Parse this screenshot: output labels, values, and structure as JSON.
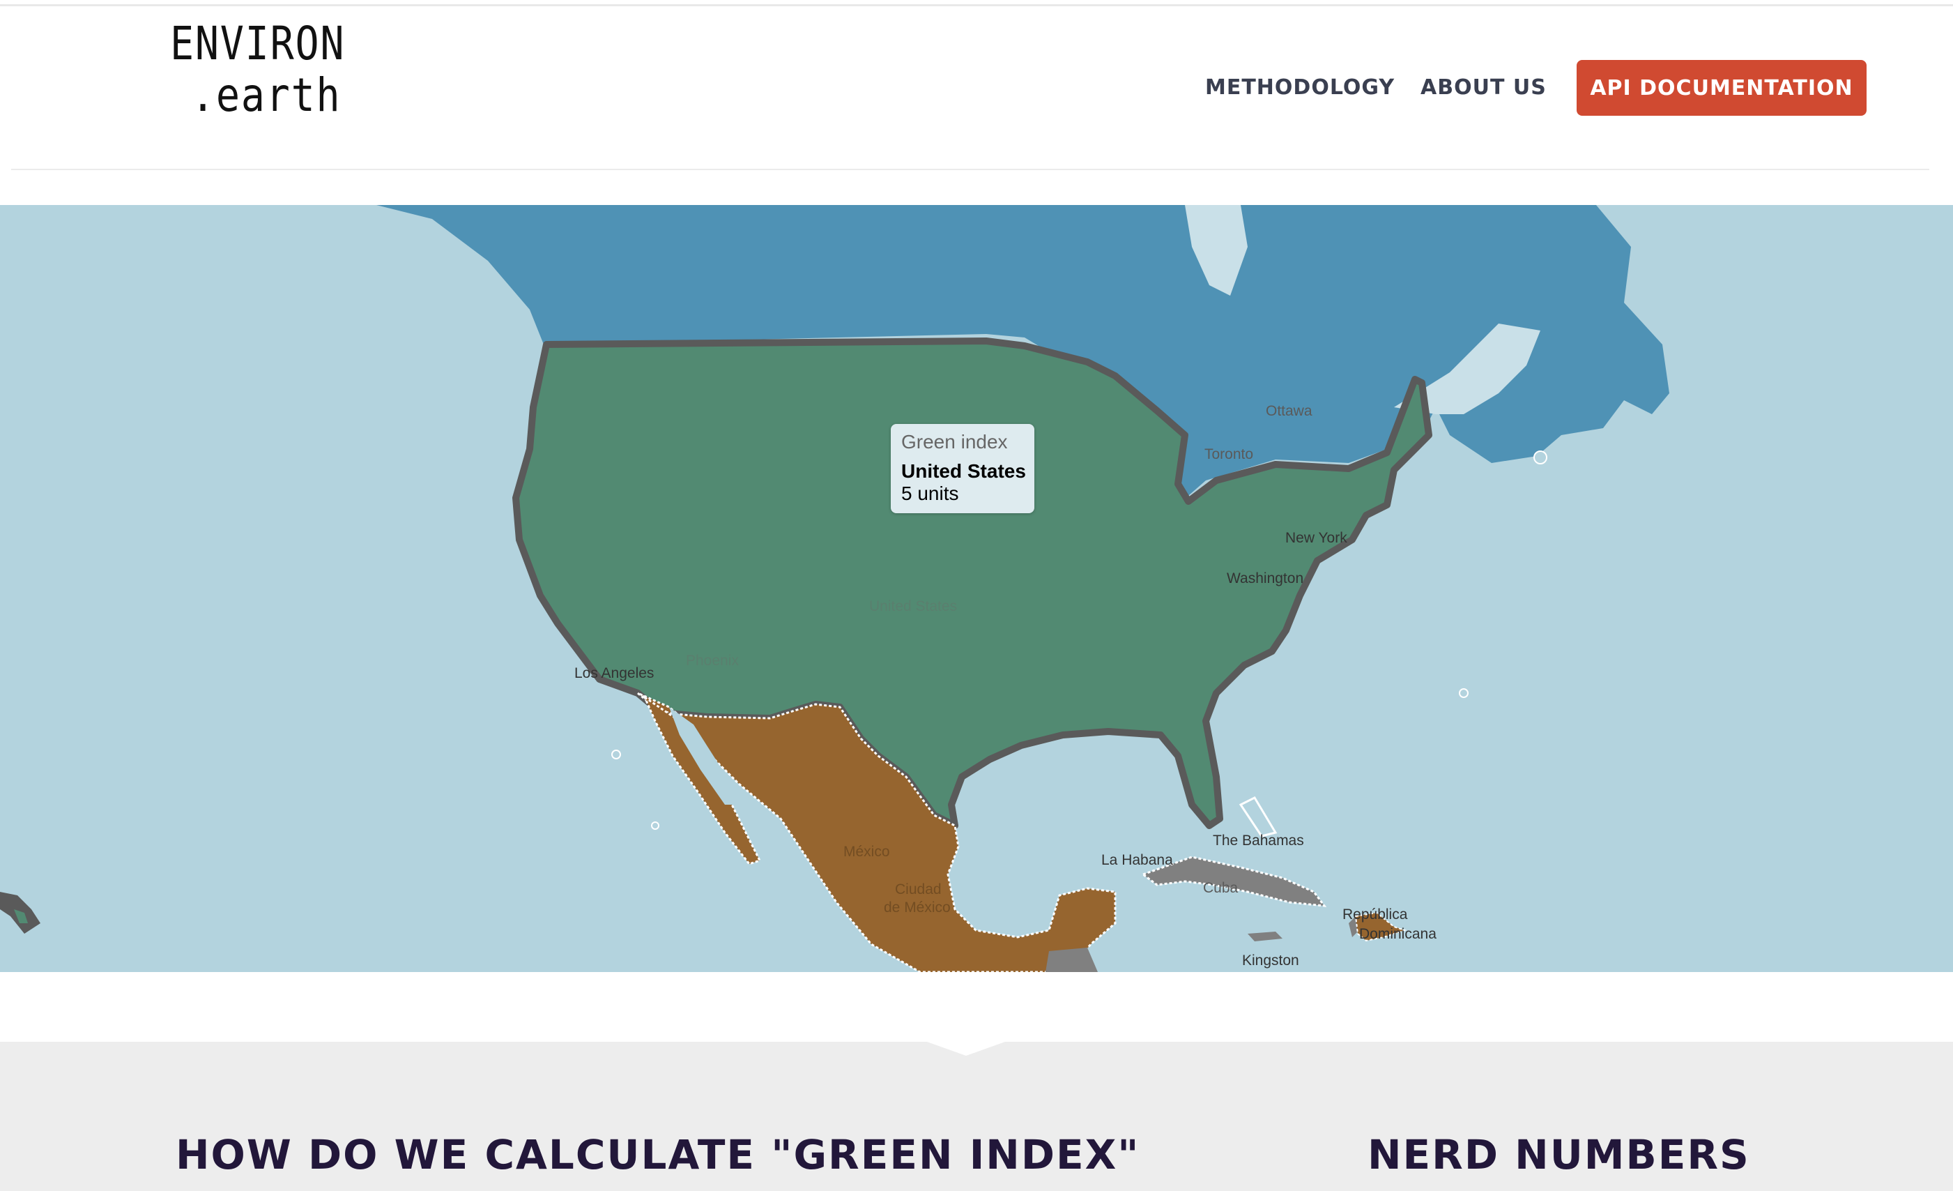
{
  "logo": {
    "line1": "ENVIRON",
    "line2": ".earth"
  },
  "nav": {
    "methodology": "METHODOLOGY",
    "about": "ABOUT US",
    "api": "API DOCUMENTATION"
  },
  "colors": {
    "accent": "#d04a31",
    "ocean": "#b3d3de",
    "canada": "#4f92b5",
    "united_states": "#528a72",
    "mexico": "#96652f",
    "no_data": "#808080",
    "heading": "#22173a"
  },
  "map": {
    "tooltip": {
      "title": "Green index",
      "country": "United States",
      "value": "5 units"
    },
    "labels": {
      "ottawa": "Ottawa",
      "toronto": "Toronto",
      "new_york": "New York",
      "washington": "Washington",
      "united_states": "United States",
      "phoenix": "Phoenix",
      "los_angeles": "Los Angeles",
      "mexico": "México",
      "mexico_city_1": "Ciudad",
      "mexico_city_2": "de México",
      "la_habana": "La Habana",
      "cuba": "Cuba",
      "bahamas": "The Bahamas",
      "kingston": "Kingston",
      "republica_1": "República",
      "republica_2": "Dominicana"
    }
  },
  "sections": {
    "green_index_heading": "HOW DO WE CALCULATE \"GREEN INDEX\"",
    "nerd_numbers_heading": "NERD NUMBERS"
  }
}
